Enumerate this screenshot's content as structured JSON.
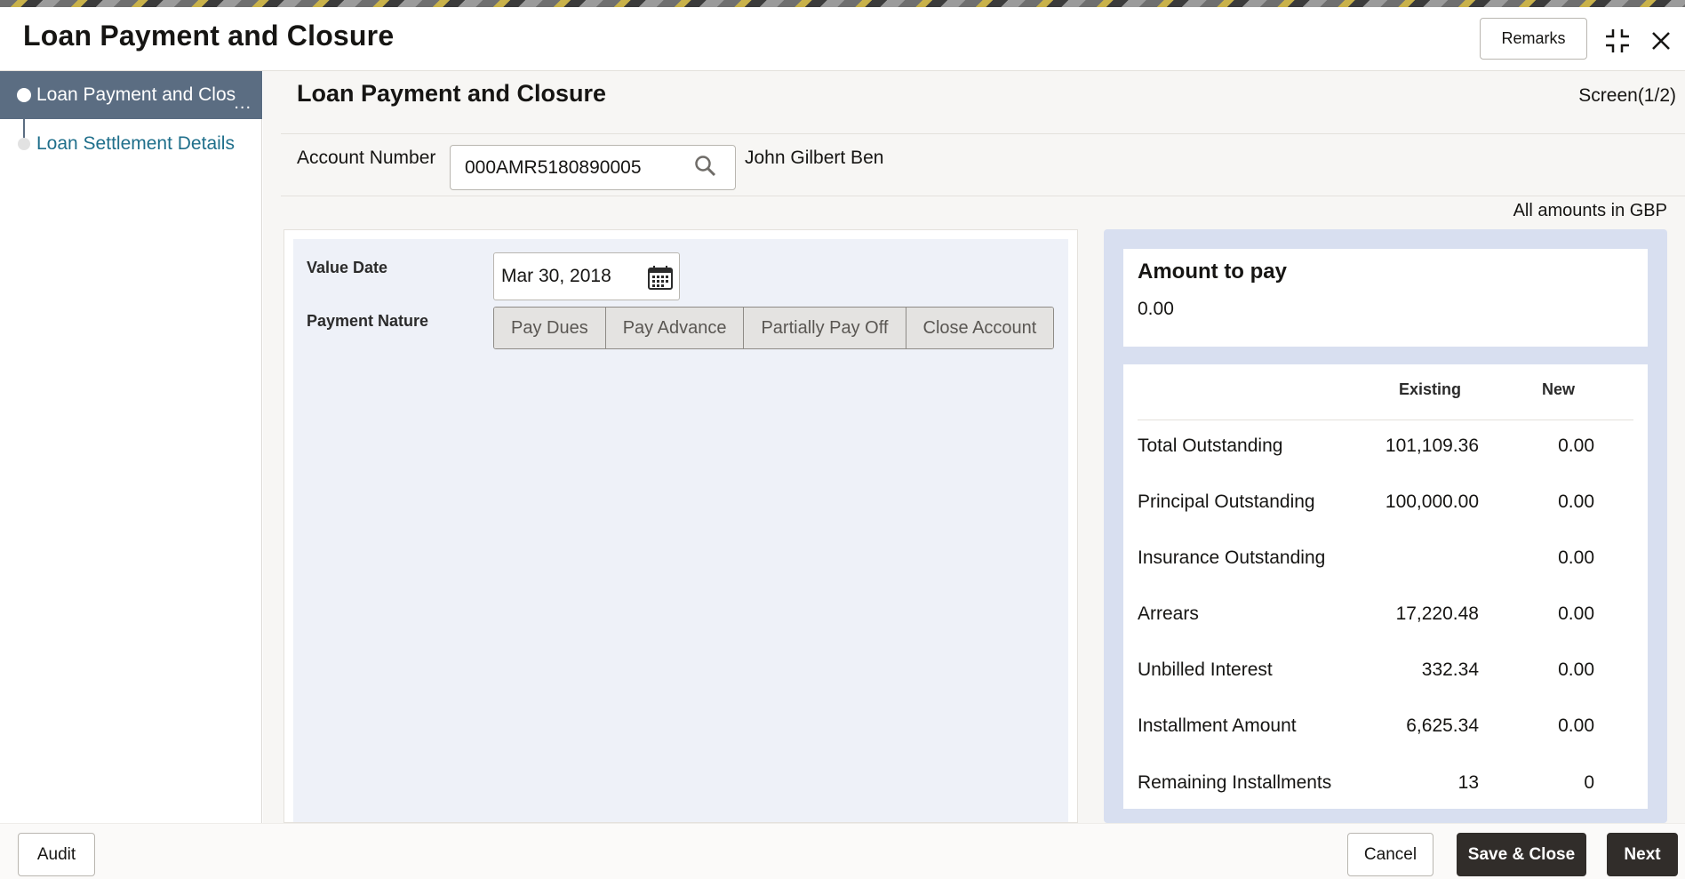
{
  "header": {
    "title": "Loan Payment and Closure",
    "remarks_label": "Remarks"
  },
  "sidebar": {
    "items": [
      {
        "label": "Loan Payment and Clos",
        "more": "..."
      },
      {
        "label": "Loan Settlement Details"
      }
    ]
  },
  "main": {
    "title": "Loan Payment and Closure",
    "screen_indicator": "Screen(1/2)",
    "account_number_label": "Account Number",
    "account_number_value": "000AMR5180890005",
    "account_holder": "John Gilbert Ben",
    "currency_note": "All amounts in GBP",
    "value_date_label": "Value Date",
    "value_date": "Mar 30, 2018",
    "payment_nature_label": "Payment Nature",
    "payment_nature_options": [
      "Pay Dues",
      "Pay Advance",
      "Partially Pay Off",
      "Close Account"
    ]
  },
  "summary": {
    "amount_to_pay_label": "Amount to pay",
    "amount_to_pay_value": "0.00",
    "col_existing": "Existing",
    "col_new": "New",
    "rows": [
      {
        "label": "Total Outstanding",
        "existing": "101,109.36",
        "new": "0.00"
      },
      {
        "label": "Principal Outstanding",
        "existing": "100,000.00",
        "new": "0.00"
      },
      {
        "label": "Insurance Outstanding",
        "existing": "",
        "new": "0.00"
      },
      {
        "label": "Arrears",
        "existing": "17,220.48",
        "new": "0.00"
      },
      {
        "label": "Unbilled Interest",
        "existing": "332.34",
        "new": "0.00"
      },
      {
        "label": "Installment Amount",
        "existing": "6,625.34",
        "new": "0.00"
      },
      {
        "label": "Remaining Installments",
        "existing": "13",
        "new": "0"
      }
    ]
  },
  "footer": {
    "audit_label": "Audit",
    "cancel_label": "Cancel",
    "save_close_label": "Save & Close",
    "next_label": "Next"
  },
  "colors": {
    "sidebar_active_bg": "#5b6d82",
    "nav_link": "#1f6f8b",
    "summary_bg": "#d8dff0",
    "form_bg": "#eef1f8",
    "primary_button": "#312d2a"
  }
}
